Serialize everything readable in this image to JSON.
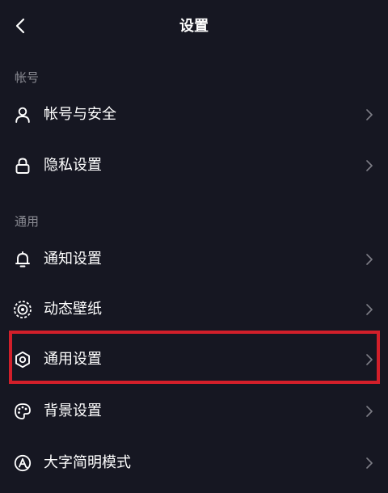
{
  "header": {
    "title": "设置",
    "back_icon": "chevron-left-icon"
  },
  "sections": [
    {
      "title": "帐号",
      "items": [
        {
          "label": "帐号与安全",
          "icon": "user-icon"
        },
        {
          "label": "隐私设置",
          "icon": "lock-icon"
        }
      ]
    },
    {
      "title": "通用",
      "items": [
        {
          "label": "通知设置",
          "icon": "bell-icon"
        },
        {
          "label": "动态壁纸",
          "icon": "live-wallpaper-icon"
        },
        {
          "label": "通用设置",
          "icon": "gear-icon"
        },
        {
          "label": "背景设置",
          "icon": "palette-icon"
        },
        {
          "label": "大字简明模式",
          "icon": "font-size-icon"
        }
      ]
    }
  ],
  "colors": {
    "background": "#161722",
    "text": "#ffffff",
    "section_text": "#8a8b93",
    "chevron": "#7d7e86",
    "highlight": "#d21f2a"
  }
}
